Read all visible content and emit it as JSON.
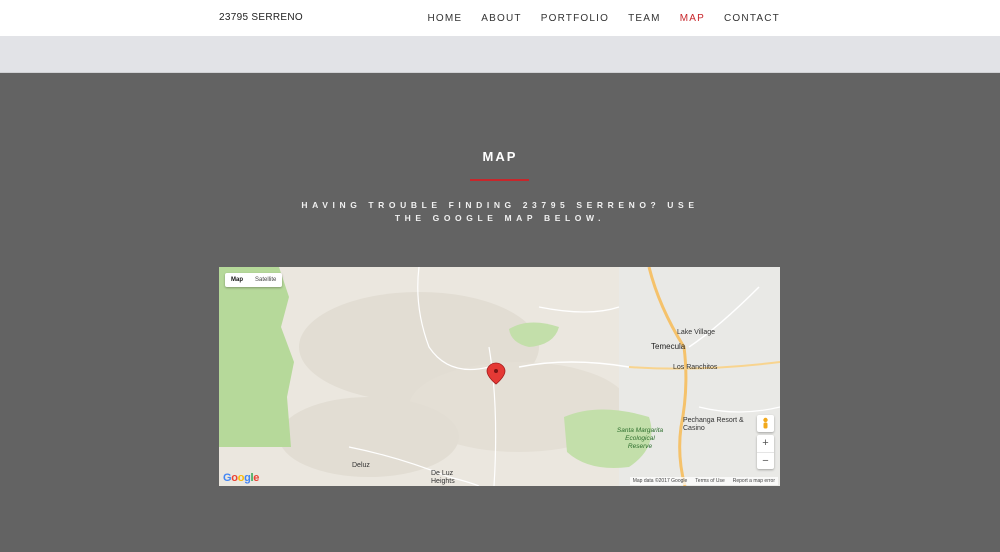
{
  "header": {
    "brand": "23795 SERRENO",
    "nav": [
      {
        "label": "HOME"
      },
      {
        "label": "ABOUT"
      },
      {
        "label": "PORTFOLIO"
      },
      {
        "label": "TEAM"
      },
      {
        "label": "MAP",
        "active": true
      },
      {
        "label": "CONTACT"
      }
    ]
  },
  "section": {
    "title": "MAP",
    "subtitle": "HAVING TROUBLE FINDING 23795 SERRENO? USE THE GOOGLE MAP BELOW."
  },
  "map": {
    "type_options": [
      "Map",
      "Satellite"
    ],
    "selected_type": "Map",
    "labels": {
      "temecula": "Temecula",
      "lake_village": "Lake Village",
      "los_ranchitos": "Los Ranchitos",
      "pechanga": "Pechanga Resort & Casino",
      "santa_margarita": "Santa Margarita Ecological Reserve",
      "deluz": "Deluz",
      "de_luz_heights": "De Luz Heights"
    },
    "attribution": {
      "map_data": "Map data ©2017 Google",
      "terms": "Terms of Use",
      "report": "Report a map error"
    },
    "zoom_in": "+",
    "zoom_out": "−",
    "logo": "Google",
    "colors": {
      "accent": "#c8262b",
      "park": "#b6d99a",
      "highway": "#f5c26b"
    }
  }
}
